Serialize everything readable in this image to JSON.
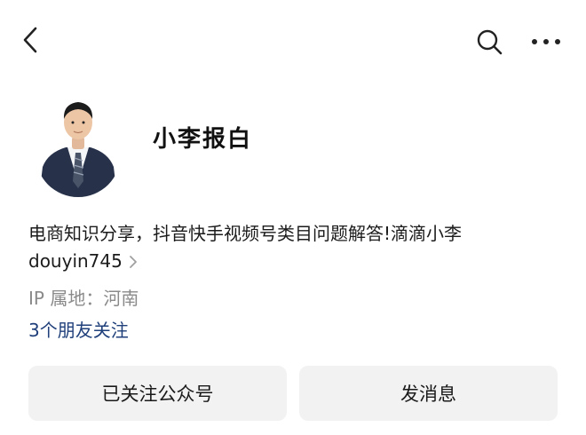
{
  "header": {
    "icons": {
      "back": "chevron-left-icon",
      "search": "search-icon",
      "more": "more-dots-icon"
    }
  },
  "profile": {
    "name": "小李报白",
    "description": "电商知识分享，抖音快手视频号类目问题解答!滴滴小李",
    "account_id": "douyin745",
    "ip_location": "IP 属地：河南",
    "friends_follow": "3个朋友关注"
  },
  "actions": {
    "followed_label": "已关注公众号",
    "message_label": "发消息"
  },
  "colors": {
    "link": "#1f3f7a",
    "muted": "#8a8a8a",
    "button_bg": "#f2f2f2"
  }
}
